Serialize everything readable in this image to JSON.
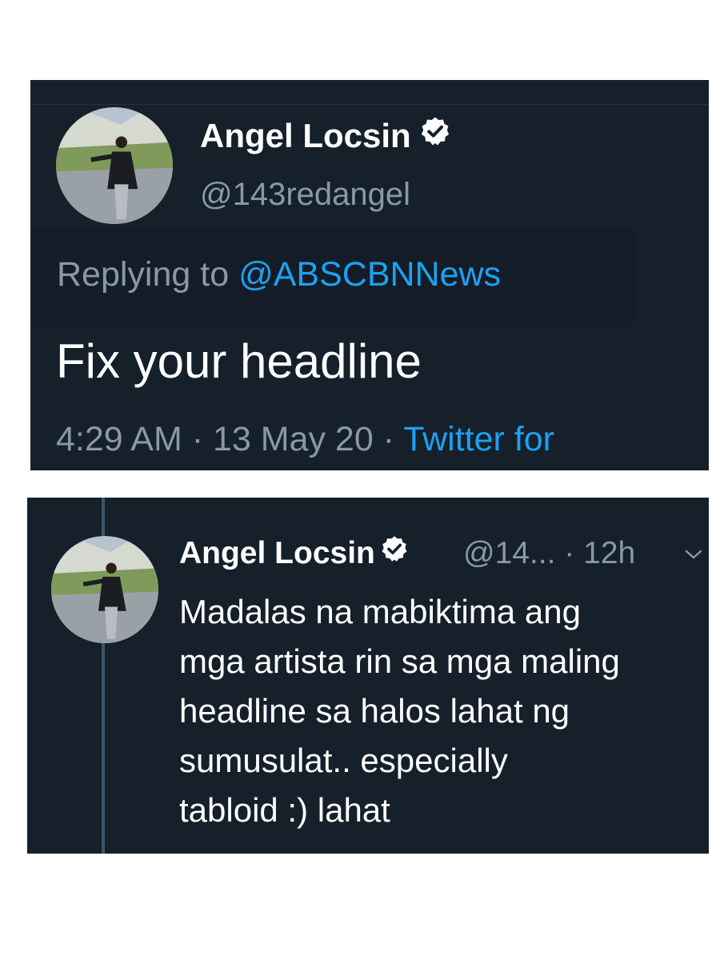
{
  "tweet1": {
    "name": "Angel Locsin",
    "handle": "@143redangel",
    "replying_prefix": "Replying to ",
    "replying_mention": "@ABSCBNNews",
    "text": "Fix your headline",
    "time_date": "4:29 AM · 13 May 20 · ",
    "source": "Twitter for"
  },
  "tweet2": {
    "name": "Angel Locsin",
    "handle_time": "@14... · 12h",
    "lines": [
      "Madalas na mabiktima ang",
      "mga artista rin sa mga maling",
      "headline sa halos lahat ng",
      "sumusulat.. especially",
      "tabloid :) lahat"
    ]
  },
  "colors": {
    "background": "#15202b",
    "accent": "#1da1f2",
    "secondary_text": "#8899a6"
  },
  "icons": [
    "verified-badge-icon",
    "chevron-down-icon"
  ]
}
